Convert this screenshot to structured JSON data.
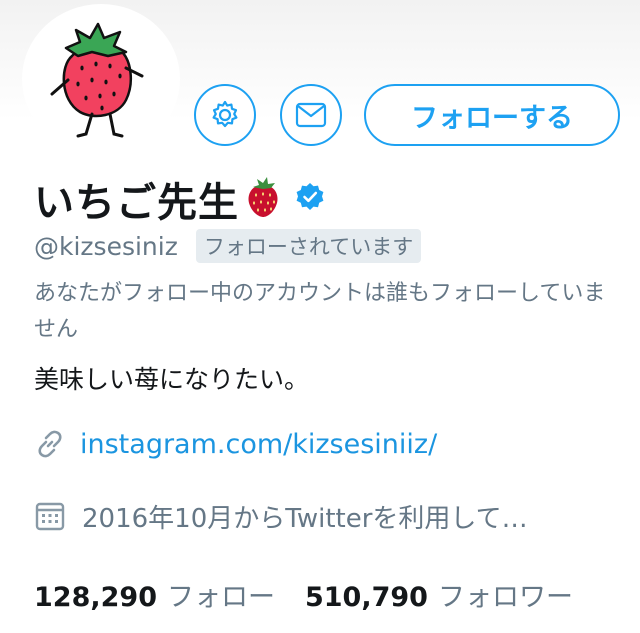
{
  "profile": {
    "display_name": "いちご先生",
    "handle": "@kizsesiniz",
    "follows_you_badge": "フォローされています",
    "mutual_followers_note": "あなたがフォロー中のアカウントは誰もフォローしていません",
    "bio": "美味しい苺になりたい。",
    "link": "instagram.com/kizsesiniiz/",
    "joined": "2016年10月からTwitterを利用して…"
  },
  "actions": {
    "follow_label": "フォローする",
    "settings_icon": "gear-icon",
    "message_icon": "mail-icon"
  },
  "stats": {
    "following_count": "128,290",
    "following_label": "フォロー",
    "followers_count": "510,790",
    "followers_label": "フォロワー"
  },
  "colors": {
    "accent": "#1da1f2",
    "link": "#1b95e0",
    "muted": "#657786",
    "text": "#14171a",
    "badge_bg": "#e6ecf0"
  }
}
